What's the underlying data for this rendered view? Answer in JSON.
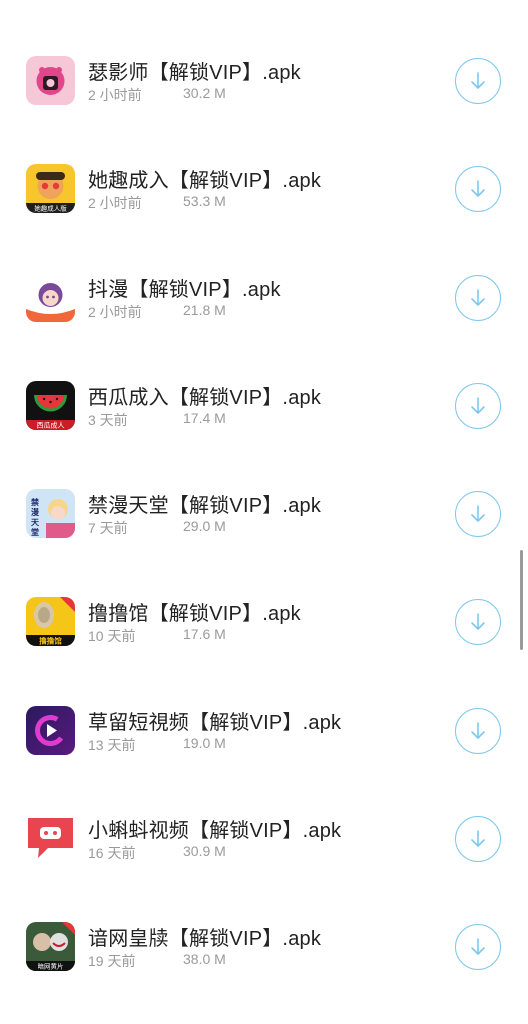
{
  "accent_color": "#7fc8ec",
  "items": [
    {
      "title": "瑟影师【解锁VIP】.apk",
      "time": "2 小时前",
      "size": "30.2 M",
      "icon": "seyingshi-app-icon",
      "download_icon": "download-arrow-icon"
    },
    {
      "title": "她趣成入【解锁VIP】.apk",
      "time": "2 小时前",
      "size": "53.3 M",
      "icon": "taqu-app-icon",
      "icon_badge": "她趣成人版",
      "download_icon": "download-arrow-icon"
    },
    {
      "title": "抖漫【解锁VIP】.apk",
      "time": "2 小时前",
      "size": "21.8 M",
      "icon": "douman-app-icon",
      "download_icon": "download-arrow-icon"
    },
    {
      "title": "西瓜成入【解锁VIP】.apk",
      "time": "3 天前",
      "size": "17.4 M",
      "icon": "xigua-app-icon",
      "icon_badge": "西瓜成人",
      "download_icon": "download-arrow-icon"
    },
    {
      "title": "禁漫天堂【解锁VIP】.apk",
      "time": "7 天前",
      "size": "29.0 M",
      "icon": "jinman-app-icon",
      "icon_badge": "禁漫天堂",
      "download_icon": "download-arrow-icon"
    },
    {
      "title": "撸撸馆【解锁VIP】.apk",
      "time": "10 天前",
      "size": "17.6 M",
      "icon": "luluguan-app-icon",
      "icon_badge": "撸撸馆",
      "download_icon": "download-arrow-icon"
    },
    {
      "title": "草留短視频【解锁VIP】.apk",
      "time": "13 天前",
      "size": "19.0 M",
      "icon": "caoliu-app-icon",
      "download_icon": "download-arrow-icon"
    },
    {
      "title": "小蝌蚪视频【解锁VIP】.apk",
      "time": "16 天前",
      "size": "30.9 M",
      "icon": "xiaokedou-app-icon",
      "download_icon": "download-arrow-icon"
    },
    {
      "title": "谙网皇牍【解锁VIP】.apk",
      "time": "19 天前",
      "size": "38.0 M",
      "icon": "anwang-app-icon",
      "icon_badge": "暗网黄片",
      "download_icon": "download-arrow-icon"
    }
  ]
}
